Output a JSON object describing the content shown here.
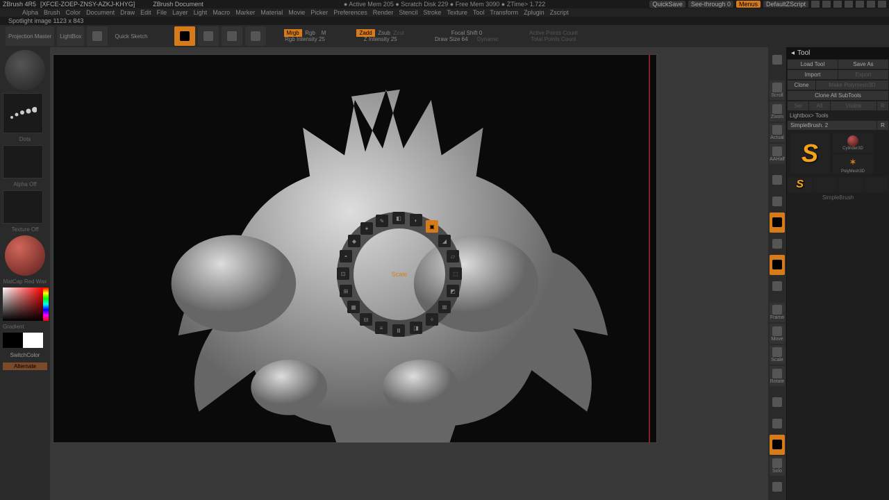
{
  "titlebar": {
    "app": "ZBrush 4R5",
    "doc_code": "[XFCE-ZOEP-ZNSY-AZKJ-KHYG]",
    "doc_label": "ZBrush Document",
    "stats": "● Active Mem 205 ● Scratch Disk 229 ● Free Mem 3090 ● ZTime> 1.722",
    "quicksave": "QuickSave",
    "seethrough": "See-through  0",
    "menus": "Menus",
    "defaultscript": "DefaultZScript"
  },
  "menu": {
    "items": [
      "Alpha",
      "Brush",
      "Color",
      "Document",
      "Draw",
      "Edit",
      "File",
      "Layer",
      "Light",
      "Macro",
      "Marker",
      "Material",
      "Movie",
      "Picker",
      "Preferences",
      "Render",
      "Stencil",
      "Stroke",
      "Texture",
      "Tool",
      "Transform",
      "Zplugin",
      "Zscript"
    ]
  },
  "statusline": "Spotlight image 1123 x 843",
  "toolbar": {
    "projection_master": "Projection Master",
    "lightbox": "LightBox",
    "quicksketch": "Quick Sketch",
    "draw": "Draw",
    "mrgb": "Mrgb",
    "rgb": "Rgb",
    "m": "M",
    "rgb_intensity": "Rgb Intensity 25",
    "zadd": "Zadd",
    "zsub": "Zsub",
    "zcut": "Zcut",
    "z_intensity": "Z Intensity 25",
    "focal_shift": "Focal Shift 0",
    "draw_size": "Draw Size 64",
    "dynamic": "Dynamic",
    "active_points": "Active Points Count",
    "total_points": "Total Points Count"
  },
  "left": {
    "stroke_label": "Dots",
    "alpha_label": "Alpha Off",
    "texture_label": "Texture Off",
    "material_label": "MatCap Red Wax",
    "gradient": "Gradient",
    "switchcolor": "SwitchColor",
    "alternate": "Alternate"
  },
  "radial": {
    "center": "Scale"
  },
  "right_icons": {
    "items_top": [
      "",
      "Scroll",
      "Zoom",
      "Actual",
      "AAHalf"
    ],
    "items_mid": [
      "",
      "",
      "",
      "",
      "",
      ""
    ],
    "items_nav": [
      "Frame",
      "Move",
      "Scale",
      "Rotate"
    ],
    "items_bot": [
      "",
      "",
      "",
      "Solo",
      ""
    ]
  },
  "tool_panel": {
    "title": "Tool",
    "load_tool": "Load Tool",
    "save_as": "Save As",
    "import": "Import",
    "export": "Export",
    "clone": "Clone",
    "make_polymesh": "Make Polymesh3D",
    "clone_all": "Clone All SubTools",
    "lightbox_tools": "Lightbox> Tools",
    "all": "All",
    "visible": "Visible",
    "r": "R",
    "current_tool": "SimpleBrush. 2",
    "thumb1": "SimpleBrush",
    "thumb2": "Cylinder3D",
    "thumb3": "PolyMesh3D",
    "thumb4": "SimpleBrush"
  }
}
